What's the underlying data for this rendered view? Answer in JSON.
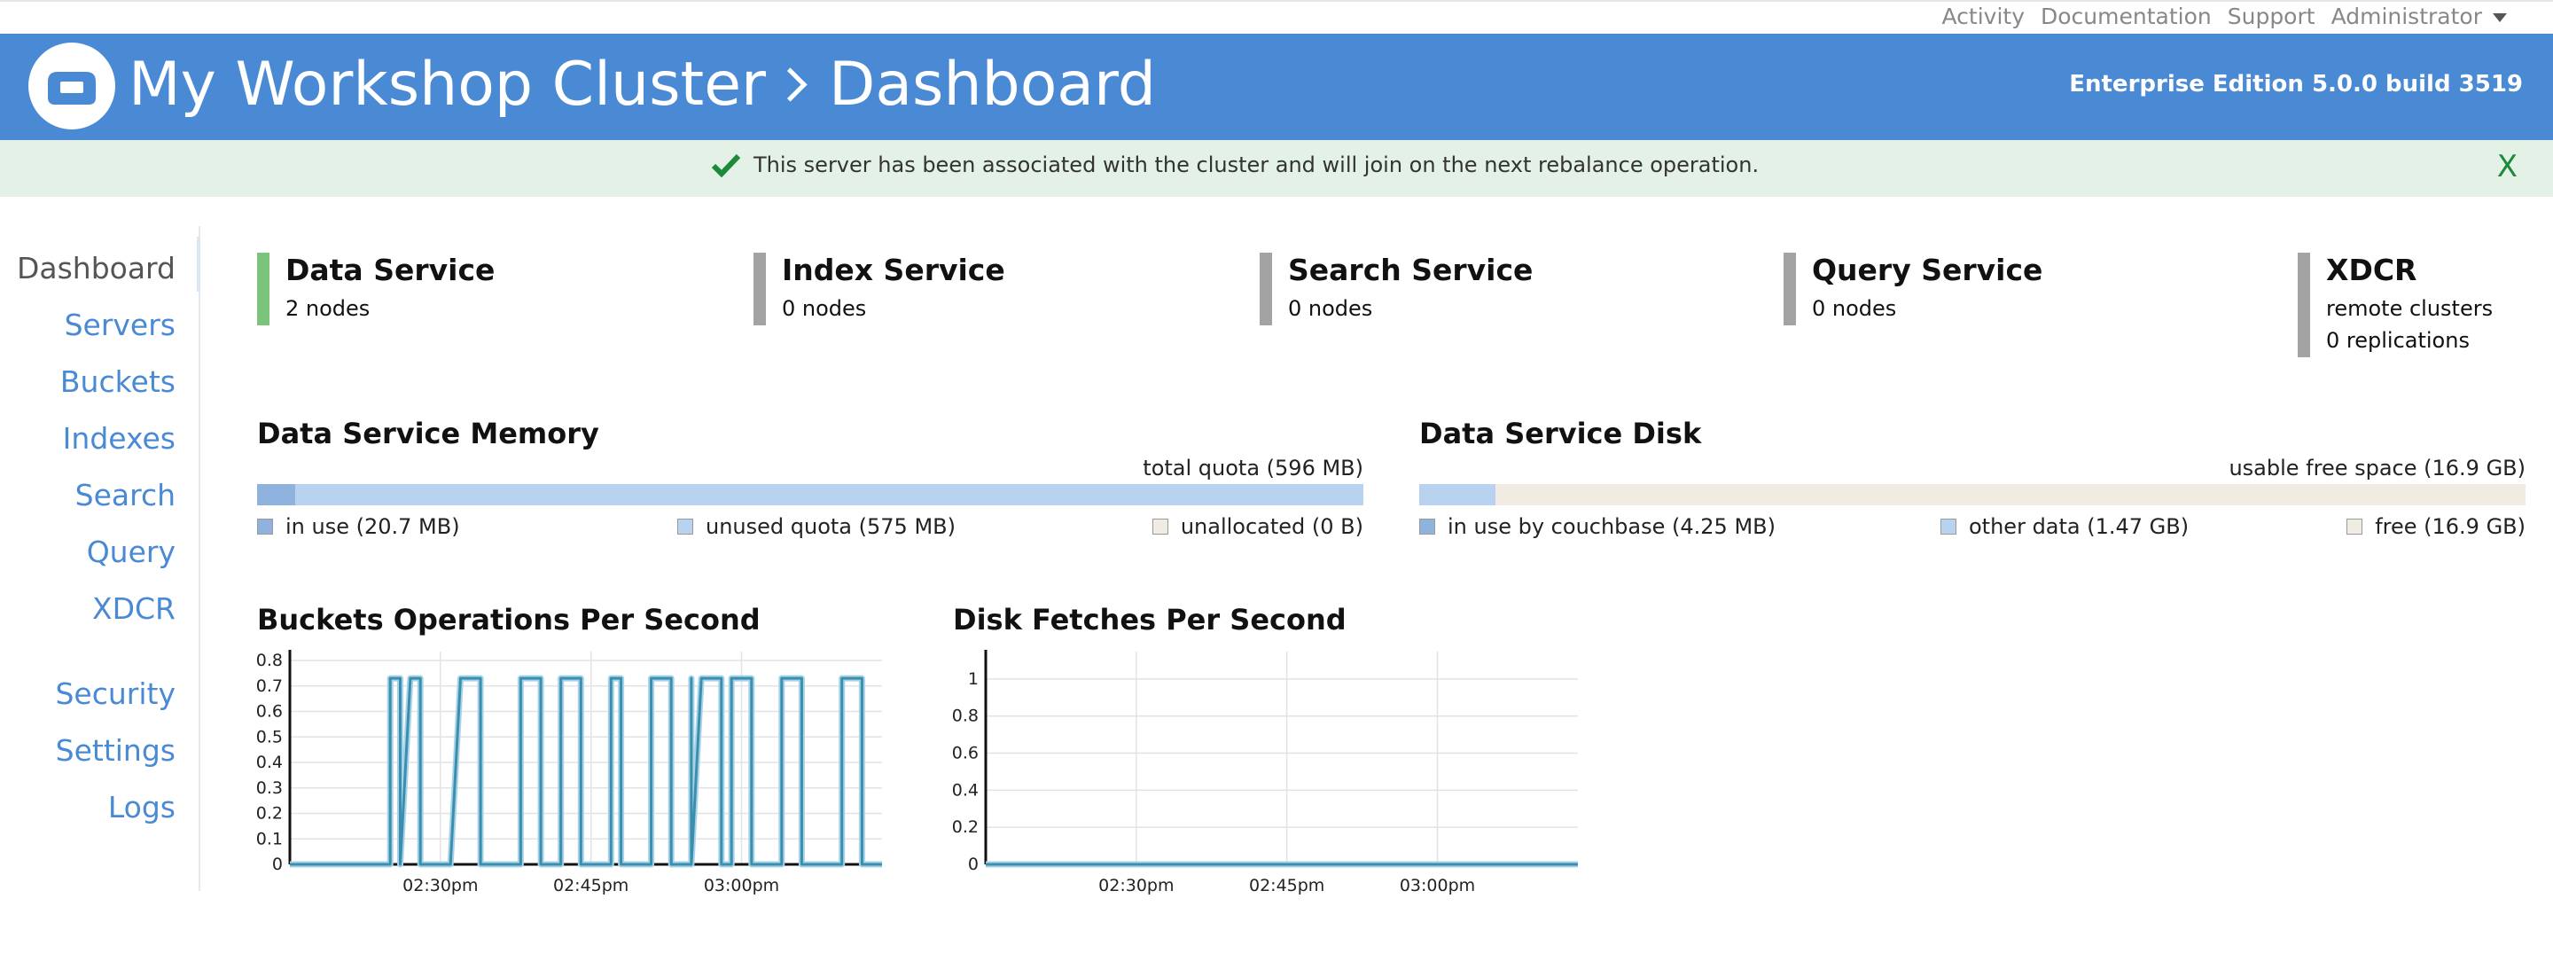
{
  "top_links": {
    "activity": "Activity",
    "documentation": "Documentation",
    "support": "Support",
    "user": "Administrator"
  },
  "header": {
    "cluster": "My Workshop Cluster",
    "page": "Dashboard",
    "edition": "Enterprise Edition 5.0.0 build 3519",
    "color": "#4a89d4"
  },
  "alert": {
    "message": "This server has been associated with the cluster and will join on the next rebalance operation.",
    "close": "X"
  },
  "sidebar": {
    "items": [
      {
        "label": "Dashboard"
      },
      {
        "label": "Servers"
      },
      {
        "label": "Buckets"
      },
      {
        "label": "Indexes"
      },
      {
        "label": "Search"
      },
      {
        "label": "Query"
      },
      {
        "label": "XDCR"
      },
      {
        "label": "Security"
      },
      {
        "label": "Settings"
      },
      {
        "label": "Logs"
      }
    ]
  },
  "services": [
    {
      "name": "Data Service",
      "line1": "2 nodes",
      "line2": "",
      "status_color": "#7cc47c"
    },
    {
      "name": "Index Service",
      "line1": "0 nodes",
      "line2": "",
      "status_color": "#a3a3a3"
    },
    {
      "name": "Search Service",
      "line1": "0 nodes",
      "line2": "",
      "status_color": "#a3a3a3"
    },
    {
      "name": "Query Service",
      "line1": "0 nodes",
      "line2": "",
      "status_color": "#a3a3a3"
    },
    {
      "name": "XDCR",
      "line1": "remote clusters",
      "line2": "0 replications",
      "status_color": "#a3a3a3"
    }
  ],
  "memory": {
    "title": "Data Service Memory",
    "total": "total quota (596 MB)",
    "legend": [
      "in use (20.7 MB)",
      "unused quota (575 MB)",
      "unallocated (0 B)"
    ],
    "fractions": [
      0.0347,
      0.9653,
      0.0
    ]
  },
  "disk": {
    "title": "Data Service Disk",
    "total": "usable free space (16.9 GB)",
    "legend": [
      "in use by couchbase (4.25 MB)",
      "other data (1.47 GB)",
      "free (16.9 GB)"
    ],
    "fractions": [
      0.0003,
      0.069,
      0.9307
    ]
  },
  "chart_data": [
    {
      "type": "line",
      "title": "Buckets Operations Per Second",
      "ylim": [
        0,
        0.8
      ],
      "yticks": [
        "0",
        "0.1",
        "0.2",
        "0.3",
        "0.4",
        "0.5",
        "0.6",
        "0.7",
        "0.8"
      ],
      "xticks": [
        "02:30pm",
        "02:45pm",
        "03:00pm"
      ],
      "xlim": [
        "02:15pm",
        "03:14pm"
      ],
      "series": [
        {
          "name": "",
          "color": "#3a8fb0",
          "points": [
            [
              "02:15pm",
              0
            ],
            [
              "02:25pm",
              0
            ],
            [
              "02:25pm",
              0.73
            ],
            [
              "02:26pm",
              0.73
            ],
            [
              "02:26pm",
              0
            ],
            [
              "02:27pm",
              0.73
            ],
            [
              "02:28pm",
              0.73
            ],
            [
              "02:28pm",
              0
            ],
            [
              "02:31pm",
              0
            ],
            [
              "02:32pm",
              0.73
            ],
            [
              "02:34pm",
              0.73
            ],
            [
              "02:34pm",
              0
            ],
            [
              "02:38pm",
              0
            ],
            [
              "02:38pm",
              0.73
            ],
            [
              "02:40pm",
              0.73
            ],
            [
              "02:40pm",
              0
            ],
            [
              "02:42pm",
              0
            ],
            [
              "02:42pm",
              0.73
            ],
            [
              "02:44pm",
              0.73
            ],
            [
              "02:44pm",
              0
            ],
            [
              "02:47pm",
              0
            ],
            [
              "02:47pm",
              0.73
            ],
            [
              "02:48pm",
              0.73
            ],
            [
              "02:48pm",
              0
            ],
            [
              "02:51pm",
              0
            ],
            [
              "02:51pm",
              0.73
            ],
            [
              "02:53pm",
              0.73
            ],
            [
              "02:53pm",
              0
            ],
            [
              "02:55pm",
              0
            ],
            [
              "02:55pm",
              0.73
            ],
            [
              "02:55pm",
              0
            ],
            [
              "02:56pm",
              0.73
            ],
            [
              "02:58pm",
              0.73
            ],
            [
              "02:58pm",
              0
            ],
            [
              "02:59pm",
              0
            ],
            [
              "02:59pm",
              0.73
            ],
            [
              "03:01pm",
              0.73
            ],
            [
              "03:01pm",
              0
            ],
            [
              "03:04pm",
              0
            ],
            [
              "03:04pm",
              0.73
            ],
            [
              "03:06pm",
              0.73
            ],
            [
              "03:06pm",
              0
            ],
            [
              "03:10pm",
              0
            ],
            [
              "03:10pm",
              0.73
            ],
            [
              "03:12pm",
              0.73
            ],
            [
              "03:12pm",
              0
            ],
            [
              "03:14pm",
              0
            ]
          ]
        }
      ]
    },
    {
      "type": "line",
      "title": "Disk Fetches Per Second",
      "ylim": [
        0,
        1.1
      ],
      "yticks": [
        "0",
        "0.2",
        "0.4",
        "0.6",
        "0.8",
        "1"
      ],
      "xticks": [
        "02:30pm",
        "02:45pm",
        "03:00pm"
      ],
      "xlim": [
        "02:15pm",
        "03:14pm"
      ],
      "series": [
        {
          "name": "",
          "color": "#3a8fb0",
          "points": [
            [
              "02:15pm",
              0
            ],
            [
              "03:14pm",
              0
            ]
          ]
        }
      ]
    }
  ]
}
